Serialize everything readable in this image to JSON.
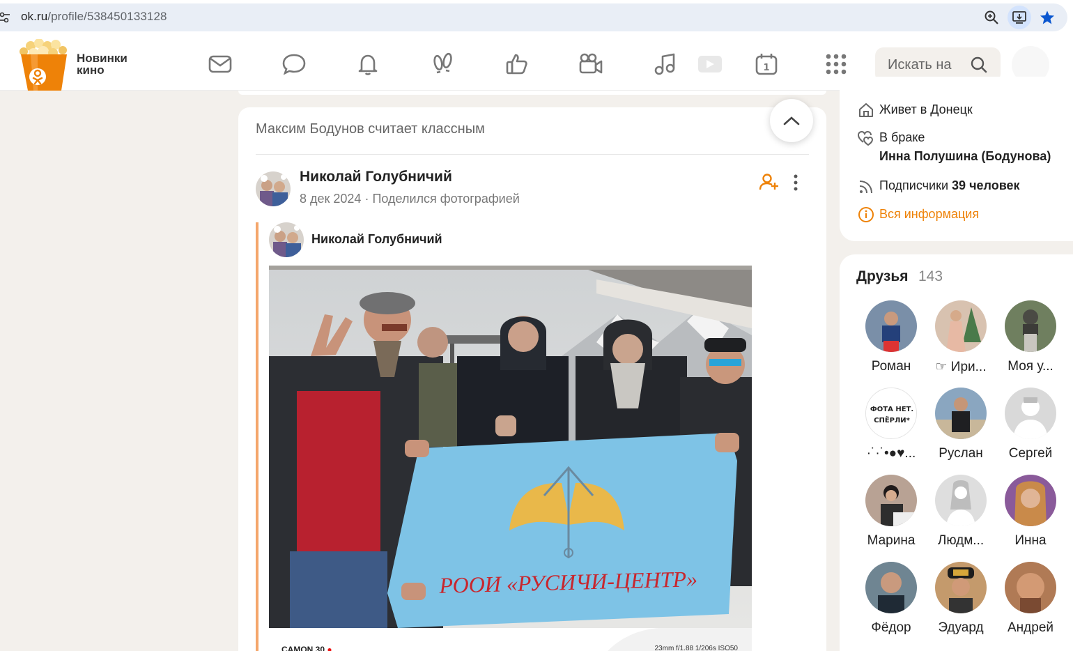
{
  "browser": {
    "url_host": "ok.ru",
    "url_path": "/profile/538450133128"
  },
  "header": {
    "promo_line1": "Новинки",
    "promo_line2": "кино",
    "nav_icons": [
      "messages-icon",
      "discussions-icon",
      "notifications-icon",
      "guests-icon",
      "likes-icon",
      "video-calls-icon",
      "music-icon",
      "video-icon",
      "events-icon",
      "apps-icon"
    ],
    "search_placeholder": "Искать на"
  },
  "feed": {
    "header_text": "Максим Бодунов считает классным",
    "post": {
      "author": "Николай Голубничий",
      "date": "8 дек 2024",
      "separator": "·",
      "action": "Поделился фотографией",
      "repost_author": "Николай Голубничий",
      "photo_banner_text": "РООИ «РУСИЧИ-ЦЕНТР»",
      "photo_footer_left": "CAMON 30",
      "photo_footer_right": "23mm f/1.88 1/206s ISO50"
    }
  },
  "profile_info": {
    "lives_label": "Живет в Донецк",
    "marital_label": "В браке",
    "spouse": "Инна Полушина (Бодунова)",
    "subscribers_label": "Подписчики",
    "subscribers_count": "39 человек",
    "all_info": "Вся информация"
  },
  "friends": {
    "title": "Друзья",
    "count": "143",
    "items": [
      {
        "name": "Роман",
        "color": "#7a8fa8"
      },
      {
        "name": "☞ Ири...",
        "color": "#d8c2b0"
      },
      {
        "name": "Моя у...",
        "color": "#6f7f5f"
      },
      {
        "name": "·˙·˙•●♥...",
        "color": "#ffffff"
      },
      {
        "name": "Руслан",
        "color": "#8aa6c0"
      },
      {
        "name": "Сергей",
        "color": "#d9d9d9"
      },
      {
        "name": "Марина",
        "color": "#b8a294"
      },
      {
        "name": "Людм...",
        "color": "#dedede"
      },
      {
        "name": "Инна",
        "color": "#8a5a9a"
      },
      {
        "name": "Фёдор",
        "color": "#6f8592"
      },
      {
        "name": "Эдуард",
        "color": "#c49a6c"
      },
      {
        "name": "Андрей",
        "color": "#b07a55"
      }
    ],
    "special_text": "ФОТА НЕТ. СПЁРЛИ*"
  },
  "colors": {
    "accent": "#ee8208",
    "page_bg": "#f3f0ec",
    "flag": "#7ec3e6",
    "repost_line": "#f4a66b"
  }
}
